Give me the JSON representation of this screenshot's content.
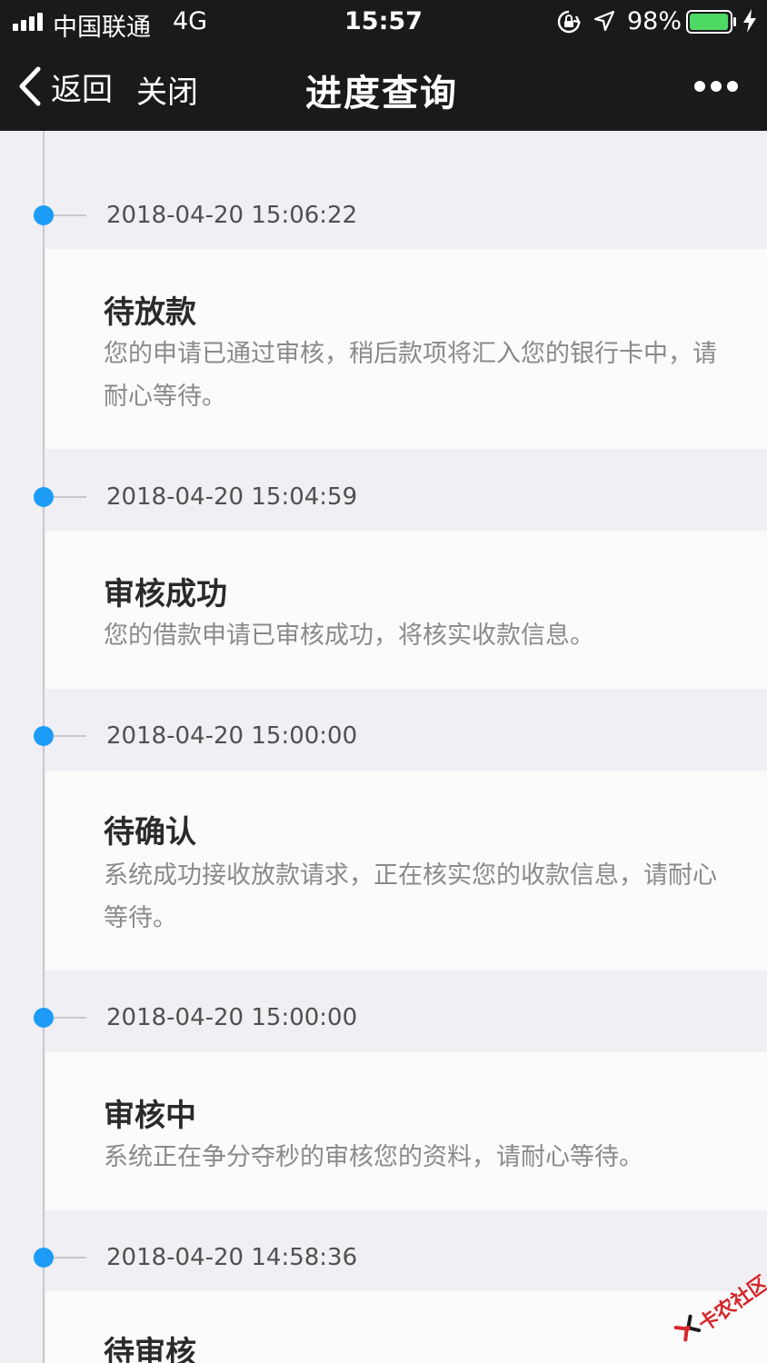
{
  "status_bar": {
    "carrier": "中国联通",
    "network": "4G",
    "time": "15:57",
    "battery_percent": "98%",
    "battery_level": 0.98,
    "battery_color": "#4cd964"
  },
  "nav": {
    "back_label": "返回",
    "close_label": "关闭",
    "title": "进度查询"
  },
  "colors": {
    "accent": "#1c9cf6",
    "nav_background": "#1a1a1d"
  },
  "timeline": [
    {
      "time": "2018-04-20 15:06:22",
      "title": "待放款",
      "description": "您的申请已通过审核，稍后款项将汇入您的银行卡中，请耐心等待。"
    },
    {
      "time": "2018-04-20 15:04:59",
      "title": "审核成功",
      "description": "您的借款申请已审核成功，将核实收款信息。"
    },
    {
      "time": "2018-04-20 15:00:00",
      "title": "待确认",
      "description": "系统成功接收放款请求，正在核实您的收款信息，请耐心等待。"
    },
    {
      "time": "2018-04-20 15:00:00",
      "title": "审核中",
      "description": "系统正在争分夺秒的审核您的资料，请耐心等待。"
    },
    {
      "time": "2018-04-20 14:58:36",
      "title": "待审核",
      "description": ""
    }
  ],
  "watermark": {
    "text": "卡农社区"
  }
}
